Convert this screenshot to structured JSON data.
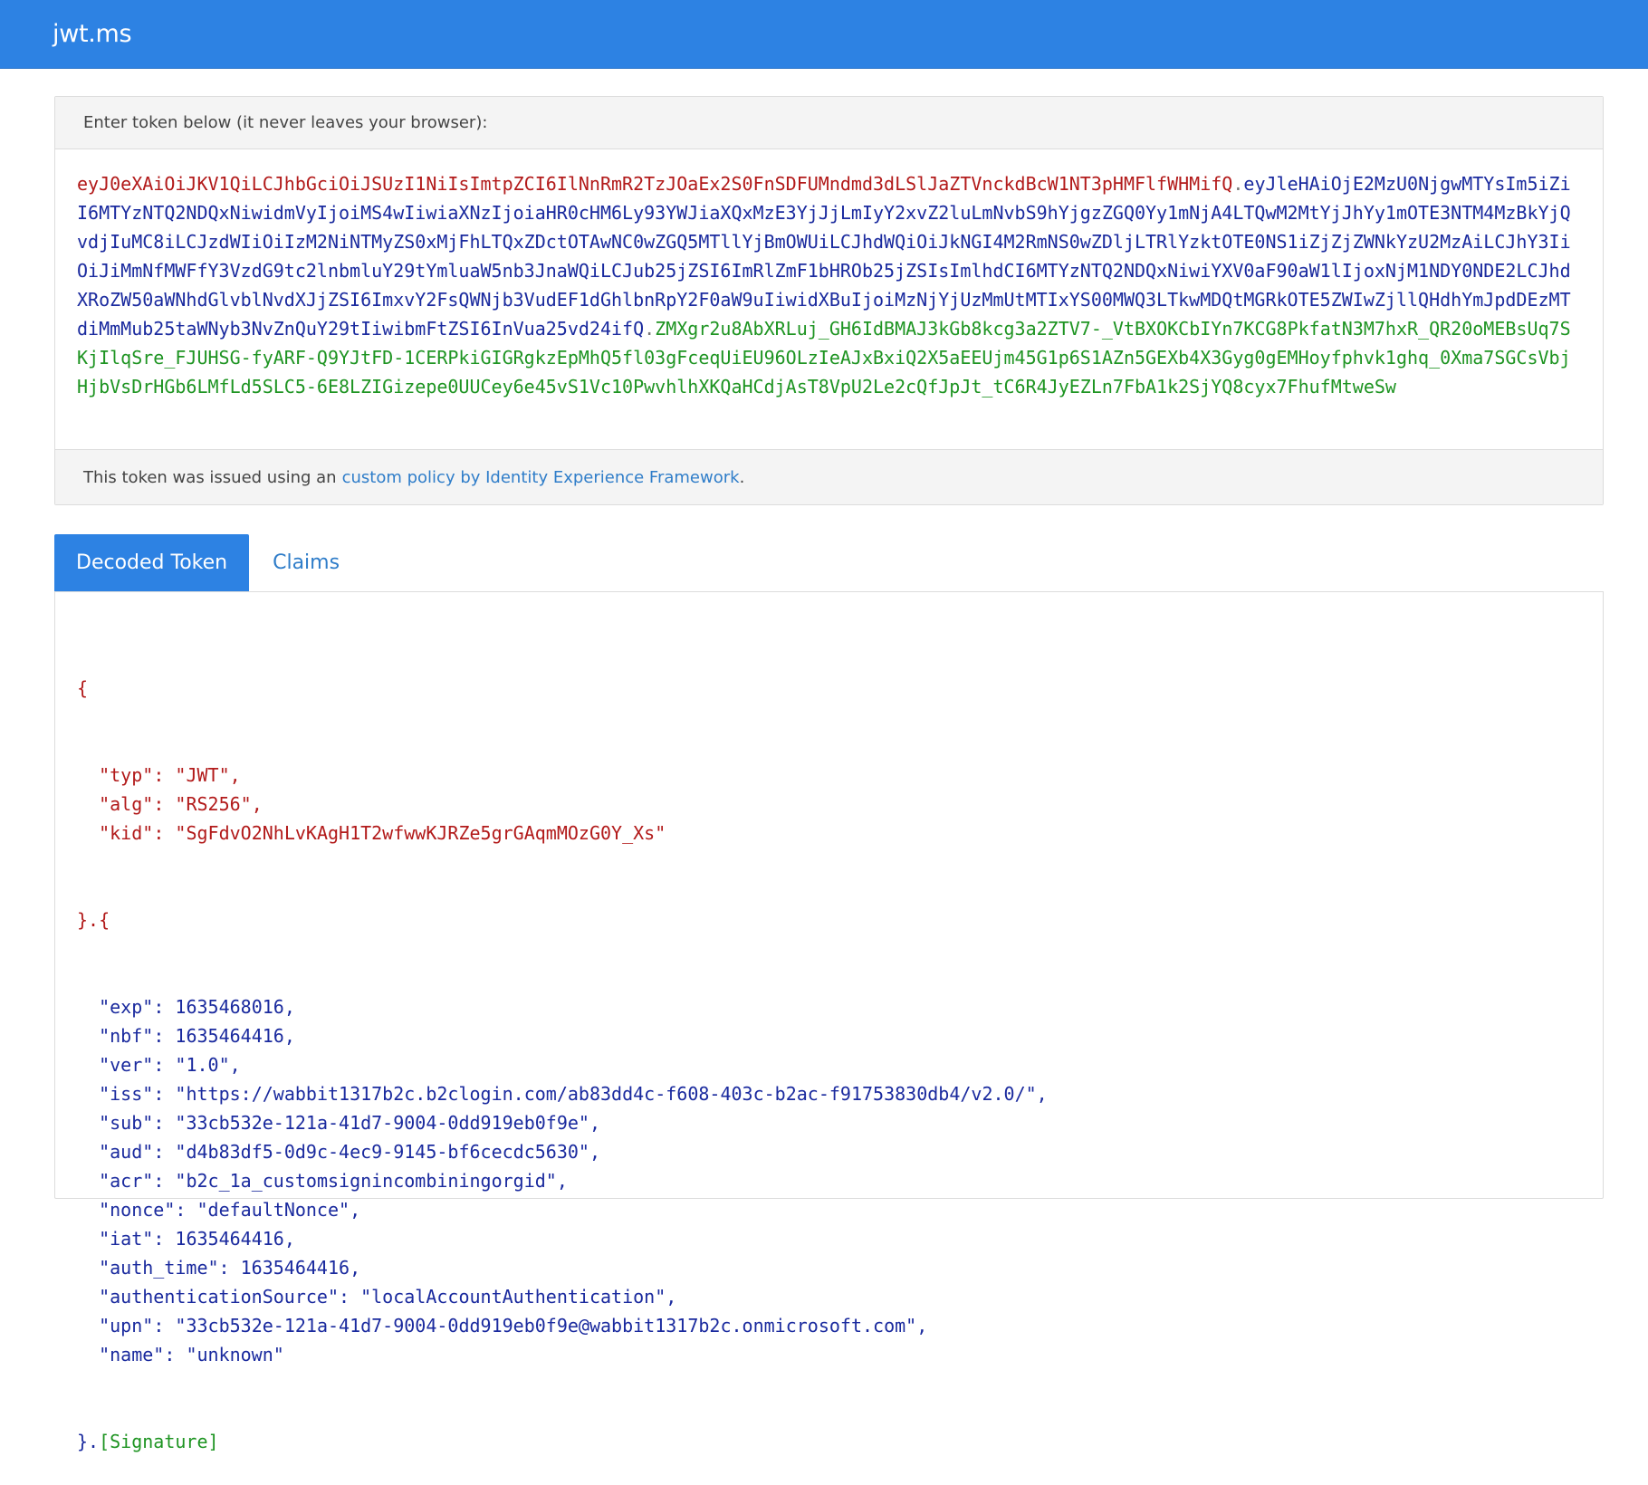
{
  "navbar": {
    "brand": "jwt.ms"
  },
  "token_panel": {
    "heading": "Enter token below (it never leaves your browser):",
    "token": {
      "header": "eyJ0eXAiOiJKV1QiLCJhbGciOiJSUzI1NiIsImtpZCI6IlNnRmR2TzJOaEx2S0FnSDFUMndmd3dLSlJaZTVnckdBcW1NT3pHMFlfWHMifQ",
      "payload": "eyJleHAiOjE2MzU0NjgwMTYsIm5iZiI6MTYzNTQ2NDQxNiwidmVyIjoiMS4wIiwiaXNzIjoiaHR0cHM6Ly93YWJiaXQxMzE3YjJjLmIyY2xvZ2luLmNvbS9hYjgzZGQ0Yy1mNjA4LTQwM2MtYjJhYy1mOTE3NTM4MzBkYjQvdjIuMC8iLCJzdWIiOiIzM2NiNTMyZS0xMjFhLTQxZDctOTAwNC0wZGQ5MTllYjBmOWUiLCJhdWQiOiJkNGI4M2RmNS0wZDljLTRlYzktOTE0NS1iZjZjZWNkYzU2MzAiLCJhY3IiOiJiMmNfMWFfY3VzdG9tc2lnbmluY29tYmluaW5nb3JnaWQiLCJub25jZSI6ImRlZmF1bHROb25jZSIsImlhdCI6MTYzNTQ2NDQxNiwiYXV0aF90aW1lIjoxNjM1NDY0NDE2LCJhdXRoZW50aWNhdGlvblNvdXJjZSI6ImxvY2FsQWNjb3VudEF1dGhlbnRpY2F0aW9uIiwidXBuIjoiMzNjYjUzMmUtMTIxYS00MWQ3LTkwMDQtMGRkOTE5ZWIwZjllQHdhYmJpdDEzMTdiMmMub25taWNyb3NvZnQuY29tIiwibmFtZSI6InVua25vd24ifQ",
      "signature": "ZMXgr2u8AbXRLuj_GH6IdBMAJ3kGb8kcg3a2ZTV7-_VtBXOKCbIYn7KCG8PkfatN3M7hxR_QR20oMEBsUq7SKjIlqSre_FJUHSG-fyARF-Q9YJtFD-1CERPkiGIGRgkzEpMhQ5fl03gFceqUiEU96OLzIeAJxBxiQ2X5aEEUjm45G1p6S1AZn5GEXb4X3Gyg0gEMHoyfphvk1ghq_0Xma7SGCsVbjHjbVsDrHGb6LMfLd5SLC5-6E8LZIGizepe0UUCey6e45vS1Vc10PwvhlhXKQaHCdjAsT8VpU2Le2cQfJpJt_tC6R4JyEZLn7FbA1k2SjYQ8cyx7FhufMtweSw"
    },
    "footer_prefix": "This token was issued using an",
    "footer_link": "custom policy by Identity Experience Framework",
    "footer_suffix": "."
  },
  "tabs": [
    {
      "label": "Decoded Token",
      "active": true
    },
    {
      "label": "Claims",
      "active": false
    }
  ],
  "decoded": {
    "header": [
      {
        "key": "\"typ\"",
        "value": "\"JWT\"",
        "comma": ","
      },
      {
        "key": "\"alg\"",
        "value": "\"RS256\"",
        "comma": ","
      },
      {
        "key": "\"kid\"",
        "value": "\"SgFdvO2NhLvKAgH1T2wfwwKJRZe5grGAqmMOzG0Y_Xs\"",
        "comma": ""
      }
    ],
    "payload": [
      {
        "key": "\"exp\"",
        "value": "1635468016",
        "comma": ","
      },
      {
        "key": "\"nbf\"",
        "value": "1635464416",
        "comma": ","
      },
      {
        "key": "\"ver\"",
        "value": "\"1.0\"",
        "comma": ","
      },
      {
        "key": "\"iss\"",
        "value": "\"https://wabbit1317b2c.b2clogin.com/ab83dd4c-f608-403c-b2ac-f91753830db4/v2.0/\"",
        "comma": ","
      },
      {
        "key": "\"sub\"",
        "value": "\"33cb532e-121a-41d7-9004-0dd919eb0f9e\"",
        "comma": ","
      },
      {
        "key": "\"aud\"",
        "value": "\"d4b83df5-0d9c-4ec9-9145-bf6cecdc5630\"",
        "comma": ","
      },
      {
        "key": "\"acr\"",
        "value": "\"b2c_1a_customsignincombiningorgid\"",
        "comma": ","
      },
      {
        "key": "\"nonce\"",
        "value": "\"defaultNonce\"",
        "comma": ","
      },
      {
        "key": "\"iat\"",
        "value": "1635464416",
        "comma": ","
      },
      {
        "key": "\"auth_time\"",
        "value": "1635464416",
        "comma": ","
      },
      {
        "key": "\"authenticationSource\"",
        "value": "\"localAccountAuthentication\"",
        "comma": ","
      },
      {
        "key": "\"upn\"",
        "value": "\"33cb532e-121a-41d7-9004-0dd919eb0f9e@wabbit1317b2c.onmicrosoft.com\"",
        "comma": ","
      },
      {
        "key": "\"name\"",
        "value": "\"unknown\"",
        "comma": ""
      }
    ],
    "open_brace": "{",
    "mid_sep": "}.{",
    "close_prefix": "}.",
    "signature_label": "[Signature]"
  }
}
